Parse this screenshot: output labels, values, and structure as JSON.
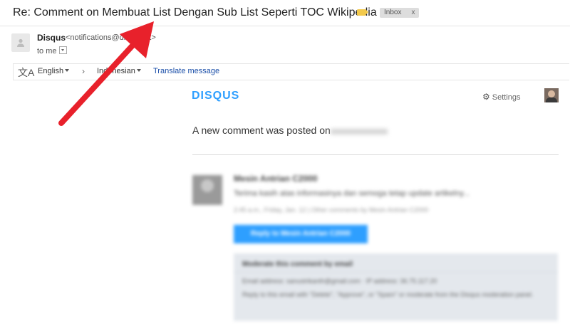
{
  "email": {
    "subject": "Re: Comment on Membuat List Dengan Sub List Seperti TOC Wikipedia",
    "label": "Inbox",
    "label_close": "x",
    "sender_name": "Disqus",
    "sender_email": "<notifications@disq...net>",
    "to_line": "to me"
  },
  "translate": {
    "source_lang": "English",
    "target_lang": "Indonesian",
    "link": "Translate message"
  },
  "disqus": {
    "logo": "DISQUS",
    "settings": "Settings",
    "headline": "A new comment was posted on",
    "commenter_name": "Mesin Antrian C2000",
    "comment_text": "Terima kasih atas informasinya dan semoga tetap update artikelny...",
    "comment_meta": "2:45 a.m., Friday, Jan. 12  |  Other comments by Mesin Antrian C2000",
    "reply_button": "Reply to Mesin Antrian C2000",
    "moderate_title": "Moderate this comment by email",
    "moderate_email": "Email address: sanustrikanth@gmail.com   ·   IP address: 36.75.117.20",
    "moderate_help": "Reply to this email with \"Delete\", \"Approve\", or \"Spam\" or moderate from the Disqus moderation panel."
  },
  "colors": {
    "accent": "#2e9fff",
    "annotation_arrow": "#e8212b",
    "label_tag": "#f2c94c"
  }
}
